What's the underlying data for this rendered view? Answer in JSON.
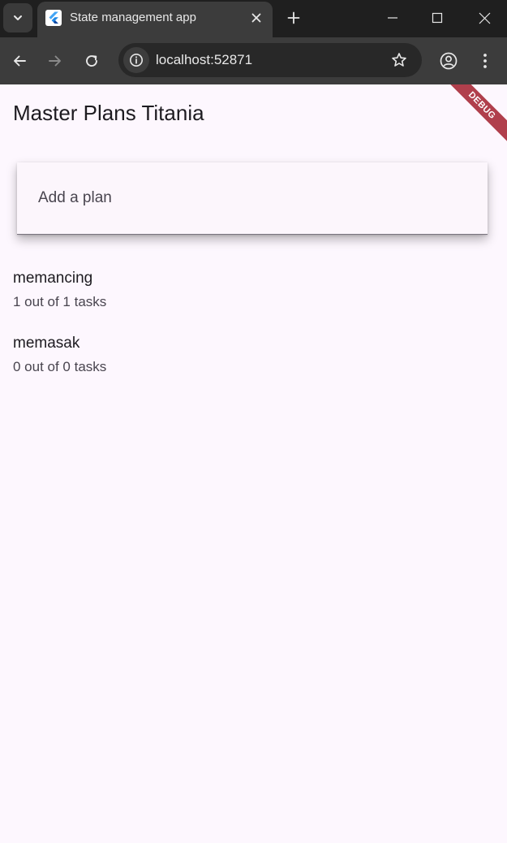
{
  "browser": {
    "tab_title": "State management app",
    "url": "localhost:52871"
  },
  "app": {
    "title": "Master Plans Titania",
    "debug_banner": "DEBUG",
    "input_placeholder": "Add a plan",
    "plans": [
      {
        "name": "memancing",
        "progress": "1 out of 1 tasks"
      },
      {
        "name": "memasak",
        "progress": "0 out of 0 tasks"
      }
    ]
  },
  "icons": {
    "tab_search": "chevron-down-icon",
    "favicon": "flutter-logo-icon",
    "close": "close-icon",
    "new_tab": "plus-icon",
    "minimize": "minimize-icon",
    "maximize": "maximize-icon",
    "window_close": "close-icon",
    "back": "arrow-left-icon",
    "forward": "arrow-right-icon",
    "reload": "reload-icon",
    "site_info": "info-icon",
    "bookmark": "star-icon",
    "profile": "account-circle-icon",
    "menu": "more-vert-icon"
  },
  "colors": {
    "app_background": "#fdf7fe",
    "debug_banner": "#a3202e",
    "chrome_dark": "#1f1f1f",
    "toolbar": "#3c3c3c"
  }
}
